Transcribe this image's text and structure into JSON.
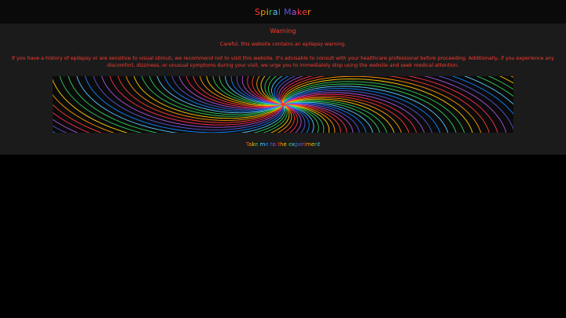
{
  "header": {
    "title": "Spiral Maker",
    "title_colors": [
      "#ff3b30",
      "#ff9500",
      "#ffcc00",
      "#34c759",
      "#5ac8fa",
      "#0a84ff",
      "#5856d6",
      "#af52de",
      "#ff2d55",
      "#ff3b30",
      "#ff9500",
      "#ffcc00"
    ]
  },
  "warning": {
    "title": "Warning",
    "line": "Careful, this website contains an epilepsy warning.",
    "body": "If you have a history of epilepsy or are sensitive to visual stimuli, we recommend not to visit this website. It's advisable to consult with your healthcare professional before proceeding. Additionally, if you experience any discomfort, dizziness, or unusual symptoms during your visit, we urge you to immediately stop using the website and seek medical attention.",
    "color": "#ff3b30"
  },
  "cta": {
    "label": "Take me to the experiment",
    "colors": [
      "#ff3b30",
      "#ff9500",
      "#ffcc00",
      "#34c759",
      "#5ac8fa",
      "#0a84ff",
      "#5856d6",
      "#af52de"
    ]
  },
  "spiral_palette": [
    "#ff3b30",
    "#ff9500",
    "#ffcc00",
    "#34c759",
    "#30d158",
    "#5ac8fa",
    "#0a84ff",
    "#5856d6",
    "#af52de",
    "#ff2d55"
  ]
}
